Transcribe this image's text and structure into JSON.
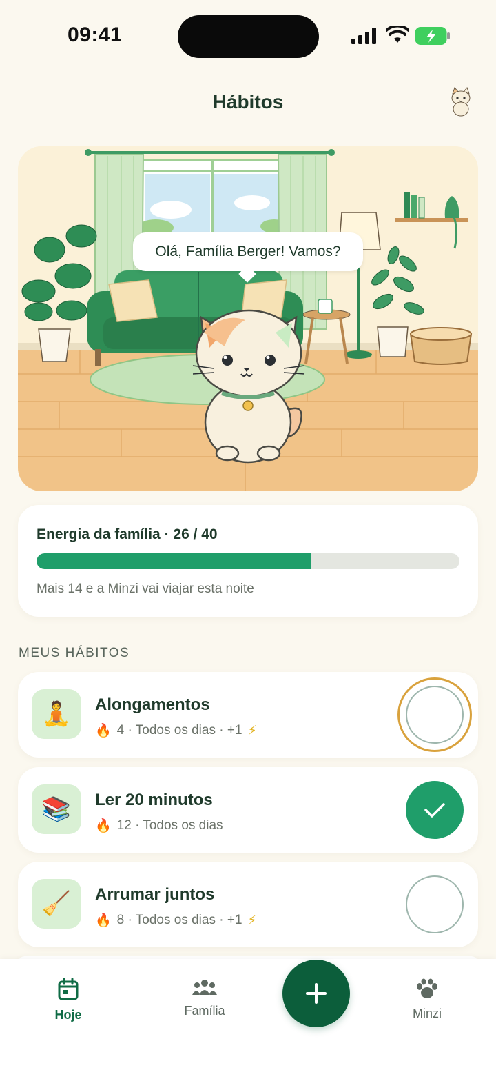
{
  "status_bar": {
    "time": "09:41",
    "icons": [
      "signal-icon",
      "wifi-icon",
      "battery-charging-icon"
    ]
  },
  "header": {
    "title": "Hábitos",
    "avatar_icon": "cat-avatar-icon"
  },
  "scene": {
    "speech": "Olá, Família Berger! Vamos?"
  },
  "energy": {
    "title": "Energia da família · 26 / 40",
    "current": 26,
    "max": 40,
    "subtitle": "Mais 14 e a Minzi vai viajar esta noite"
  },
  "section_label": "MEUS HÁBITOS",
  "habits": [
    {
      "name": "Alongamentos",
      "streak": "🔥",
      "meta": "4 · Todos os dias · +1",
      "bonus": "⚡",
      "icon": "🧘",
      "done": false,
      "focused": true
    },
    {
      "name": "Ler 20 minutos",
      "streak": "🔥",
      "meta": "12 · Todos os dias",
      "bonus": "",
      "icon": "📚",
      "done": true,
      "focused": false
    },
    {
      "name": "Arrumar juntos",
      "streak": "🔥",
      "meta": "8 · Todos os dias · +1",
      "bonus": "⚡",
      "icon": "🧹",
      "done": false,
      "focused": false
    }
  ],
  "nav": {
    "today": "Hoje",
    "family": "Família",
    "add": "+",
    "pet": "Minzi"
  },
  "colors": {
    "accent": "#1f9e6a",
    "dark_green": "#0c5e3b",
    "focus_ring": "#d9a23d",
    "background": "#fbf8ef"
  }
}
